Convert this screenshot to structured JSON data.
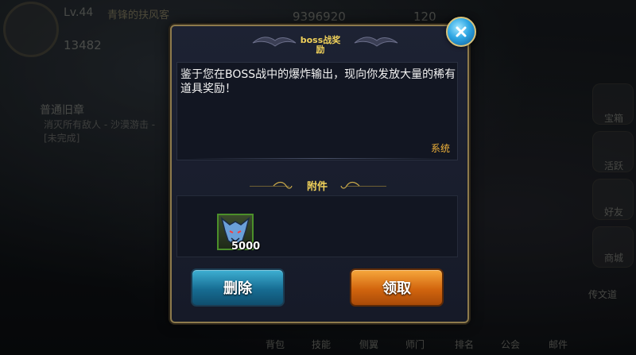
{
  "background_hud": {
    "level": "Lv.44",
    "player_name": "青锋的扶风客",
    "power_value": "13482",
    "gold_value": "9396920",
    "stamina_value": "120",
    "quest_title": "普通旧章",
    "quest_line1": "消灭所有敌人 - 沙漠游击 -",
    "quest_line2": "[未完成]",
    "right_labels": [
      "宝箱",
      "活跃",
      "好友",
      "商城"
    ],
    "bottom_labels": [
      "背包",
      "技能",
      "侧翼",
      "师门",
      "排名",
      "公会",
      "邮件"
    ],
    "bottom_right_label": "传文道"
  },
  "dialog": {
    "title": "boss战奖励",
    "message": "鉴于您在BOSS战中的爆炸输出，现向你发放大量的稀有道具奖励！",
    "sender": "系统",
    "attachment_header": "附件",
    "attachments": [
      {
        "icon": "wolf-head-icon",
        "count": "5000"
      }
    ],
    "delete_label": "删除",
    "claim_label": "领取"
  },
  "colors": {
    "title_gold": "#f0d15a",
    "sender_orange": "#f0b23a",
    "delete_blue": "#176d93",
    "claim_orange": "#d2650e",
    "frame_gold": "#8d7a4c"
  }
}
